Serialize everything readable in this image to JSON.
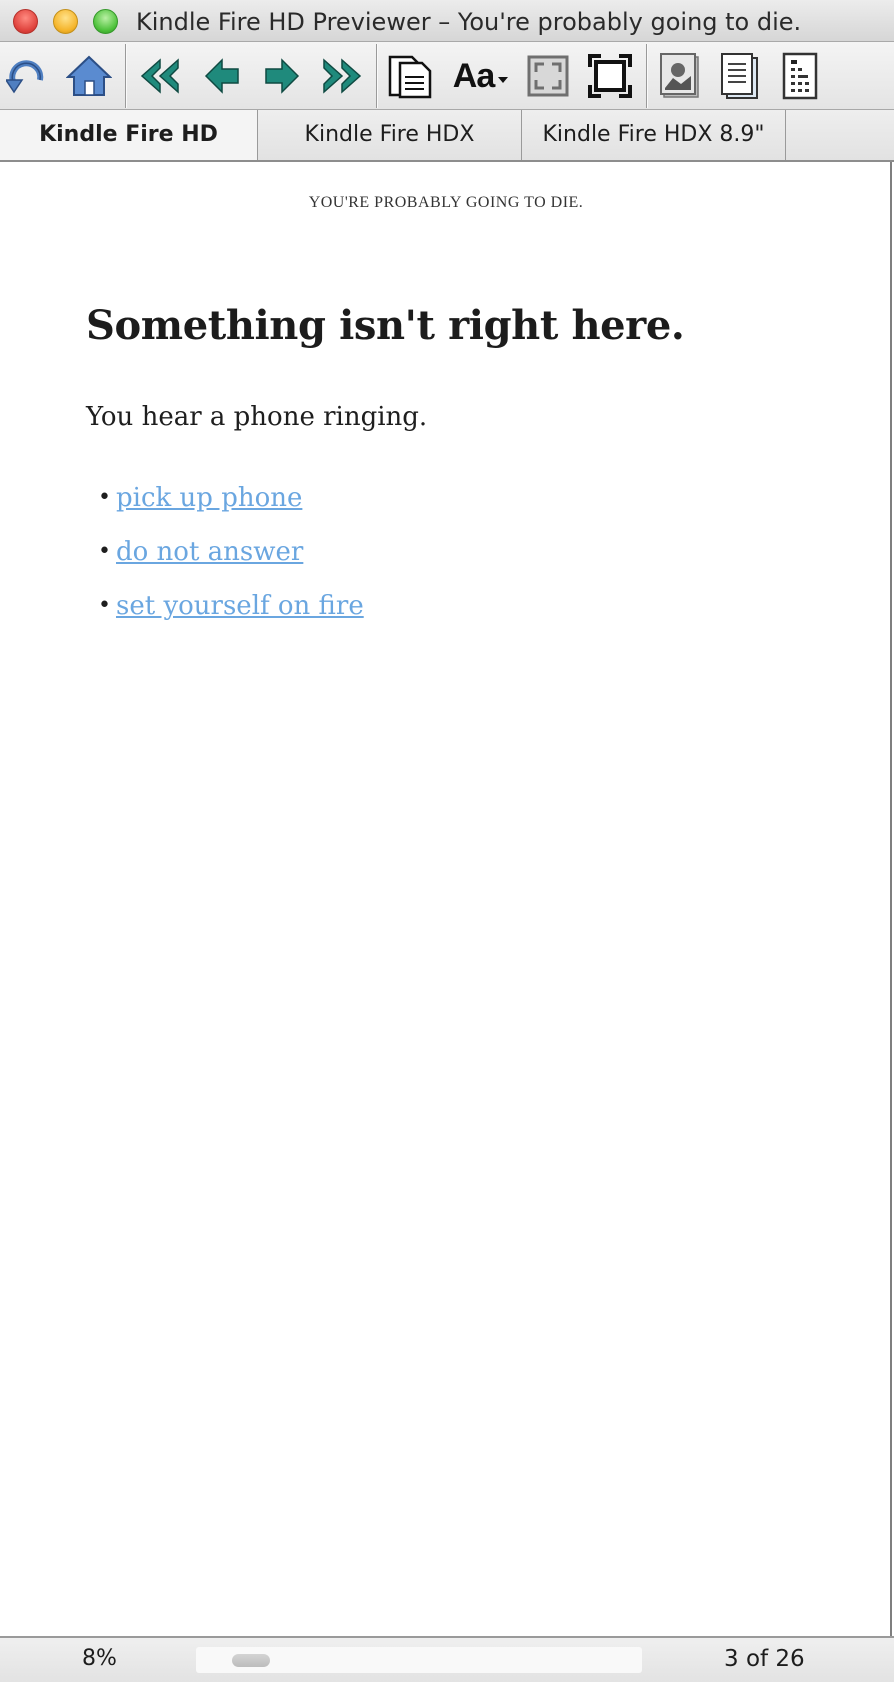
{
  "window": {
    "title": "Kindle Fire HD Previewer – You're probably going to die."
  },
  "toolbar": {
    "buttons": [
      {
        "icon": "rotate-icon",
        "label": "Rotate"
      },
      {
        "icon": "home-icon",
        "label": "Home"
      },
      {
        "icon": "first-page-icon",
        "label": "First"
      },
      {
        "icon": "previous-page-icon",
        "label": "Previous"
      },
      {
        "icon": "next-page-icon",
        "label": "Next"
      },
      {
        "icon": "last-page-icon",
        "label": "Last"
      },
      {
        "icon": "page-view-icon",
        "label": "Page view"
      },
      {
        "icon": "font-size-icon",
        "label": "Aa"
      },
      {
        "icon": "fullscreen-icon",
        "label": "Full screen"
      },
      {
        "icon": "fit-icon",
        "label": "Fit"
      },
      {
        "icon": "image-icon",
        "label": "Image"
      },
      {
        "icon": "document-icon",
        "label": "Document"
      },
      {
        "icon": "table-of-contents-icon",
        "label": "Table of contents"
      }
    ],
    "font_label": "Aa"
  },
  "tabs": [
    {
      "label": "Kindle Fire HD",
      "active": true
    },
    {
      "label": "Kindle Fire HDX",
      "active": false
    },
    {
      "label": "Kindle Fire HDX 8.9\"",
      "active": false
    }
  ],
  "content": {
    "running_head": "YOU'RE PROBABLY GOING TO DIE.",
    "heading": "Something isn't right here.",
    "paragraph": "You hear a phone ringing.",
    "choices": [
      {
        "bullet": "•",
        "text": "pick up phone"
      },
      {
        "bullet": "•",
        "text": "do not answer"
      },
      {
        "bullet": "•",
        "text": "set yourself on fire"
      }
    ],
    "link_color": "#6aa6e0"
  },
  "status": {
    "zoom": "8%",
    "progress_fraction": 0.08,
    "page_count": "3 of 26"
  },
  "colors": {
    "close": "#e0443e",
    "minimize": "#f5b52c",
    "zoom": "#4fc23c",
    "nav_teal": "#1f8a7c",
    "home_blue": "#4f7fc1"
  }
}
